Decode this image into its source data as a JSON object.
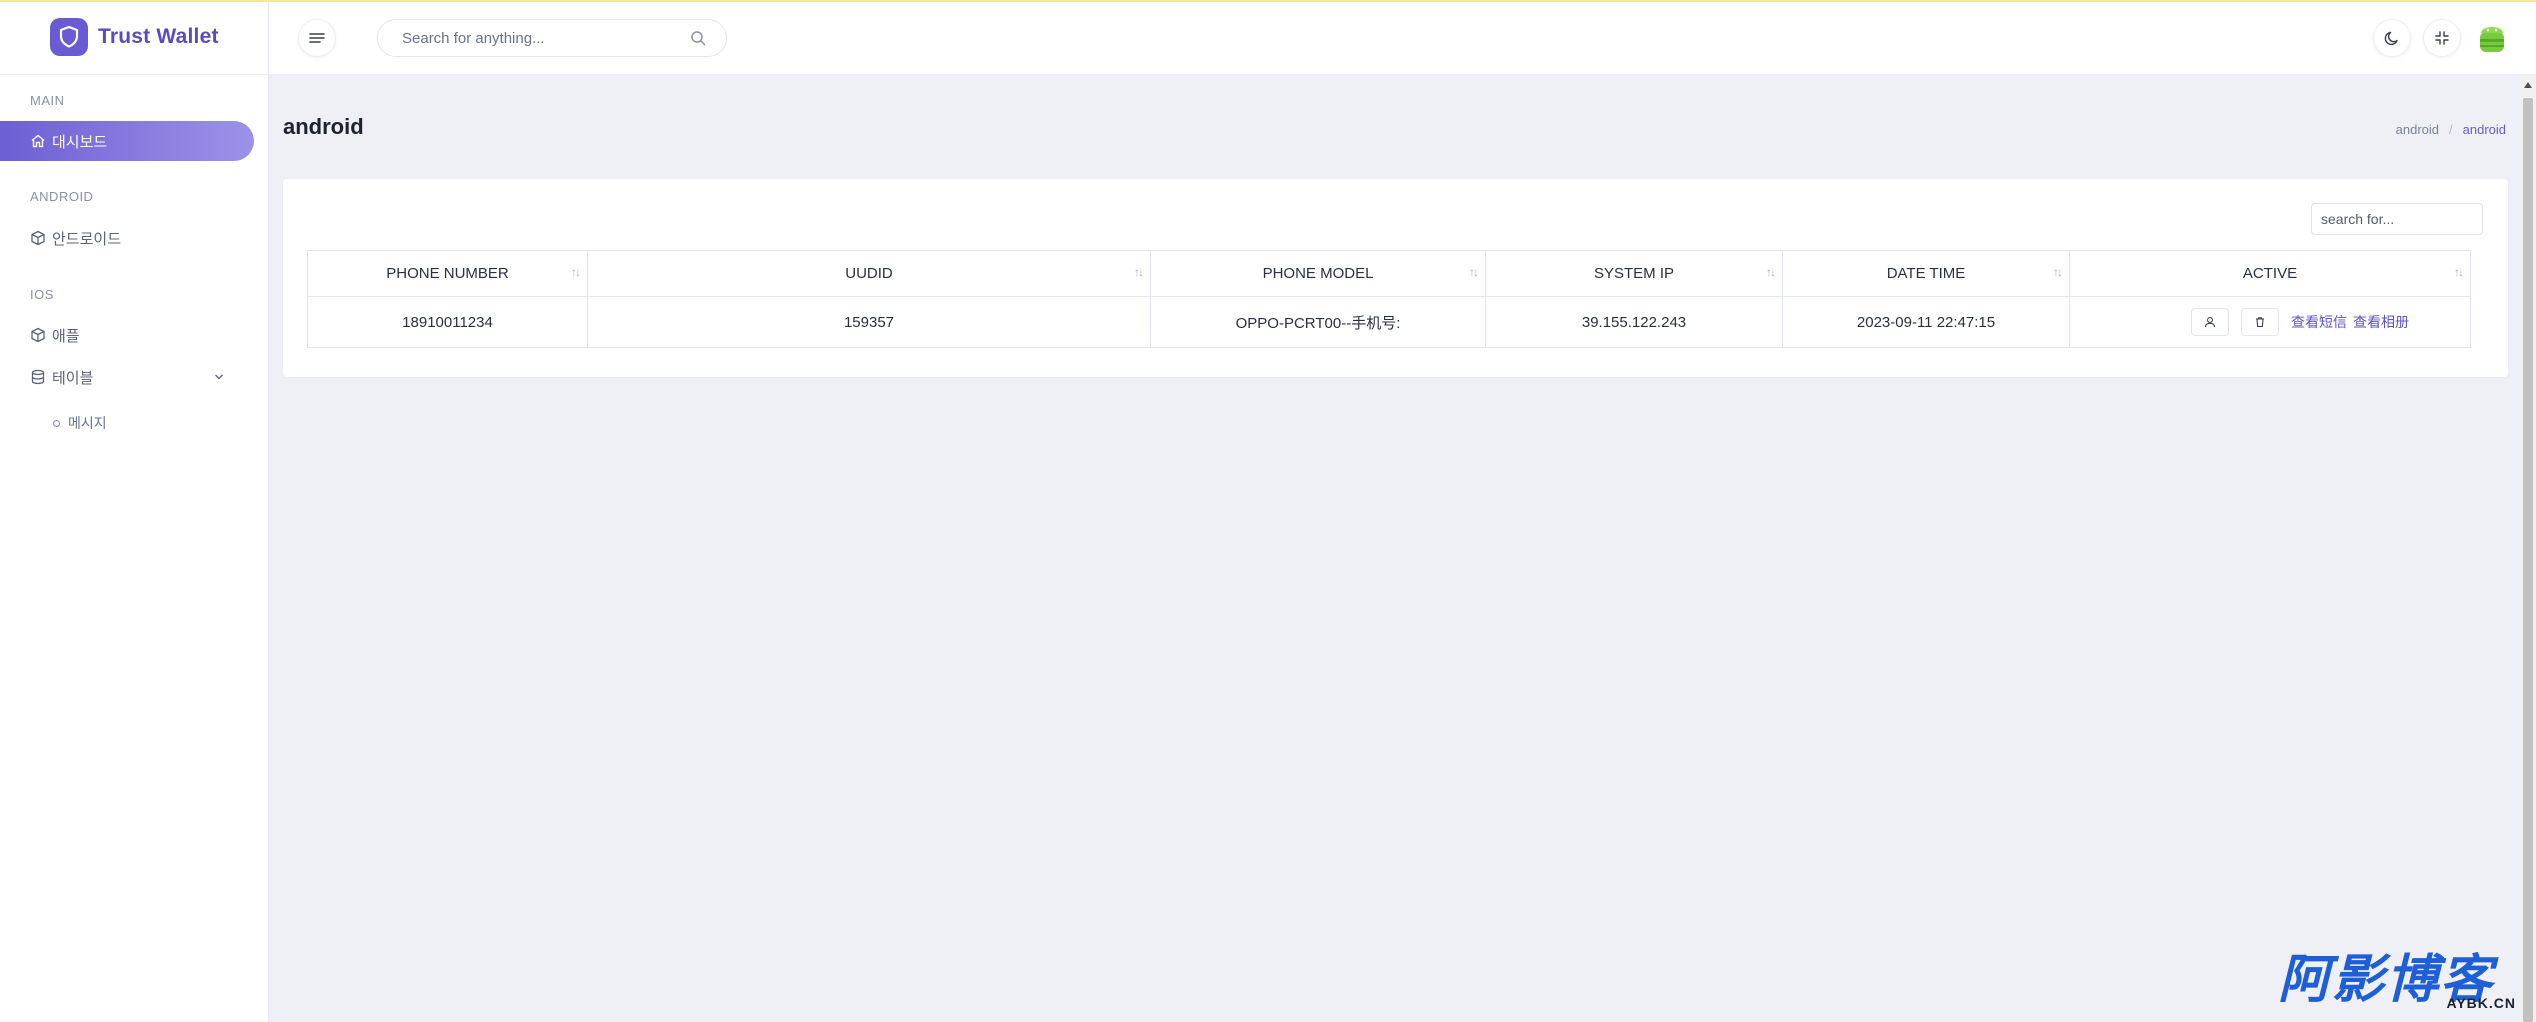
{
  "brand": {
    "name": "Trust Wallet"
  },
  "sidebar": {
    "sections": [
      "MAIN",
      "ANDROID",
      "IOS"
    ],
    "items": [
      {
        "label": "대시보드",
        "icon": "home-icon"
      },
      {
        "label": "안드로이드",
        "icon": "cube-icon"
      },
      {
        "label": "애플",
        "icon": "cube-icon"
      },
      {
        "label": "테이블",
        "icon": "database-icon"
      }
    ],
    "sub_items": [
      {
        "label": "메시지"
      }
    ]
  },
  "header": {
    "search_placeholder": "Search for anything..."
  },
  "page": {
    "title": "android",
    "breadcrumb": [
      "android",
      "android"
    ]
  },
  "table": {
    "search_placeholder": "search for...",
    "columns": [
      "PHONE NUMBER",
      "UUDID",
      "PHONE MODEL",
      "SYSTEM IP",
      "DATE TIME",
      "ACTIVE"
    ],
    "rows": [
      {
        "phone_number": "18910011234",
        "uudid": "159357",
        "phone_model": "OPPO-PCRT00--手机号:",
        "system_ip": "39.155.122.243",
        "date_time": "2023-09-11 22:47:15",
        "links": [
          "查看短信",
          "查看相册"
        ]
      }
    ]
  },
  "watermark": {
    "main": "阿影博客",
    "sub": "AYBK.CN"
  },
  "colors": {
    "accent": "#6a5bd3",
    "link": "#5b57c9",
    "background": "#eef0f5"
  }
}
